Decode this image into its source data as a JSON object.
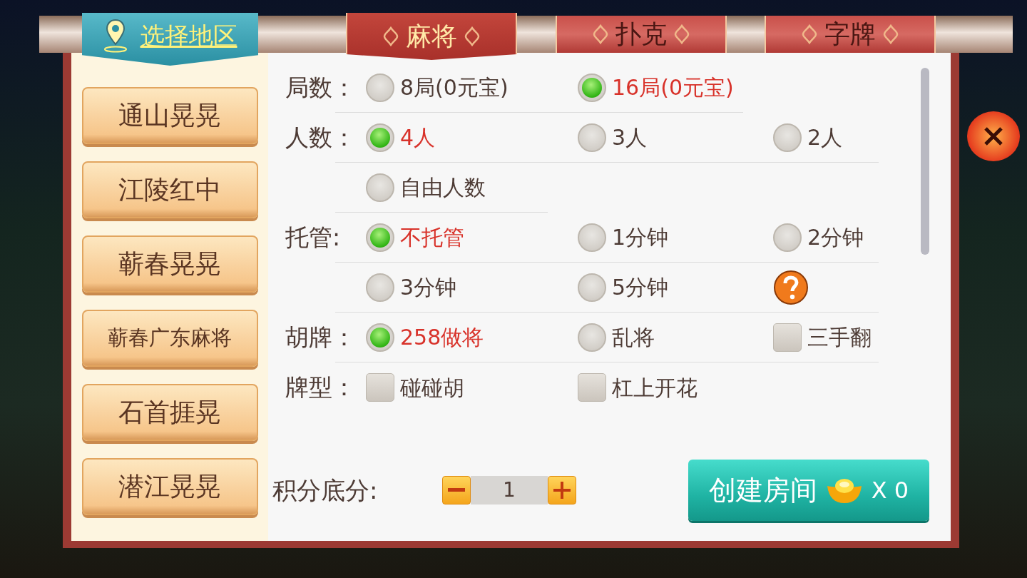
{
  "header": {
    "region_tab": {
      "label": "选择地区"
    },
    "game_tabs": [
      {
        "label": "麻将",
        "selected": true
      },
      {
        "label": "扑克",
        "selected": false
      },
      {
        "label": "字牌",
        "selected": false
      }
    ]
  },
  "regions": [
    {
      "label": "通山晃晃"
    },
    {
      "label": "江陵红中"
    },
    {
      "label": "蕲春晃晃"
    },
    {
      "label": "蕲春广东麻将"
    },
    {
      "label": "石首捱晃"
    },
    {
      "label": "潜江晃晃"
    }
  ],
  "options": [
    {
      "label": "局数：",
      "choices": [
        {
          "kind": "radio",
          "text": "8局(0元宝)",
          "checked": false
        },
        {
          "kind": "radio",
          "text": "16局(0元宝)",
          "checked": true
        }
      ]
    },
    {
      "label": "人数：",
      "choices": [
        {
          "kind": "radio",
          "text": "4人",
          "checked": true
        },
        {
          "kind": "radio",
          "text": "3人",
          "checked": false
        },
        {
          "kind": "radio",
          "text": "2人",
          "checked": false
        },
        {
          "kind": "radio",
          "text": "自由人数",
          "checked": false
        }
      ]
    },
    {
      "label": "托管:",
      "choices": [
        {
          "kind": "radio",
          "text": "不托管",
          "checked": true
        },
        {
          "kind": "radio",
          "text": "1分钟",
          "checked": false
        },
        {
          "kind": "radio",
          "text": "2分钟",
          "checked": false
        },
        {
          "kind": "radio",
          "text": "3分钟",
          "checked": false
        },
        {
          "kind": "radio",
          "text": "5分钟",
          "checked": false
        },
        {
          "kind": "help"
        }
      ]
    },
    {
      "label": "胡牌：",
      "choices": [
        {
          "kind": "radio",
          "text": "258做将",
          "checked": true
        },
        {
          "kind": "radio",
          "text": "乱将",
          "checked": false
        },
        {
          "kind": "checkbox",
          "text": "三手翻",
          "checked": false
        }
      ]
    },
    {
      "label": "牌型：",
      "choices": [
        {
          "kind": "checkbox",
          "text": "碰碰胡",
          "checked": false
        },
        {
          "kind": "checkbox",
          "text": "杠上开花",
          "checked": false
        }
      ]
    }
  ],
  "score": {
    "label": "积分底分:",
    "value": "1"
  },
  "create_button": {
    "label": "创建房间",
    "cost": "X 0"
  }
}
